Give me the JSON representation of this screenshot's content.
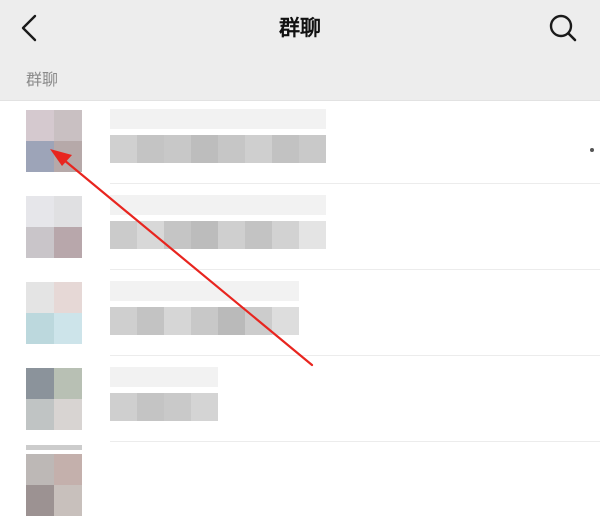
{
  "nav": {
    "title": "群聊",
    "back_icon": "chevron-left-icon",
    "search_icon": "search-icon"
  },
  "section": {
    "label": "群聊"
  },
  "colors": {
    "nav_background": "#ededed",
    "annotation_arrow": "#e8251f"
  },
  "group_chats": [
    {
      "avatar_tiles": [
        "#d5c9cf",
        "#c9c0c2",
        "#9da4b8",
        "#b6a9a9"
      ],
      "title_tones": [
        "#d0d0d0",
        "#c4c4c4",
        "#c8c8c8",
        "#bdbdbd",
        "#c6c6c6",
        "#cfcfcf",
        "#c2c2c2",
        "#c9c9c9"
      ]
    },
    {
      "avatar_tiles": [
        "#e6e6ea",
        "#e0e0e2",
        "#c9c5c9",
        "#b8a7ab"
      ],
      "title_tones": [
        "#cbcbcb",
        "#d8d8d8",
        "#c5c5c5",
        "#bcbcbc",
        "#cfcfcf",
        "#c3c3c3",
        "#d2d2d2",
        "#e4e4e4"
      ]
    },
    {
      "avatar_tiles": [
        "#e4e4e4",
        "#e6d8d6",
        "#bcd8dd",
        "#cde4ea"
      ],
      "title_tones": [
        "#cfcfcf",
        "#c3c3c3",
        "#d6d6d6",
        "#c8c8c8",
        "#bababa",
        "#cccccc",
        "#dddddd"
      ]
    },
    {
      "avatar_tiles": [
        "#8b939b",
        "#b8c0b4",
        "#c0c4c4",
        "#d8d4d2"
      ],
      "title_tones": [
        "#cfcfcf",
        "#c4c4c4",
        "#c9c9c9",
        "#d4d4d4"
      ]
    },
    {
      "avatar_tiles": [
        "#bdb8b6",
        "#c4b0ac",
        "#9c9292",
        "#c8c0bc"
      ],
      "title_tones": []
    }
  ]
}
